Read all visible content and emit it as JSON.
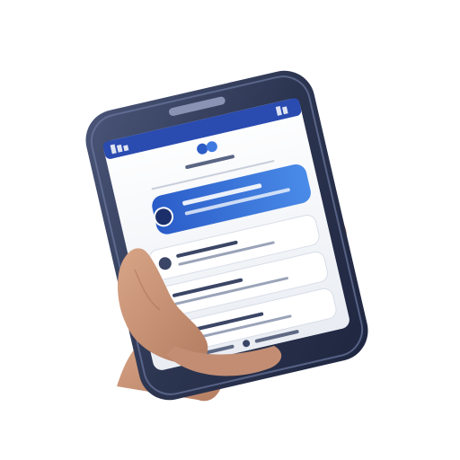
{
  "scene": {
    "subject": "hand-holding-smartphone",
    "phone_body_color": "#2c3550",
    "phone_bezel_color": "#3d4766",
    "screen_bg_color": "#f2f4f7",
    "screen_header_color": "#2a4bb0",
    "accent_banner_color": "#2f6fd8",
    "skin_color": "#c99577"
  },
  "ui_rows": [
    {
      "kind": "avatar-row"
    },
    {
      "kind": "avatar-row"
    },
    {
      "kind": "avatar-row"
    }
  ]
}
